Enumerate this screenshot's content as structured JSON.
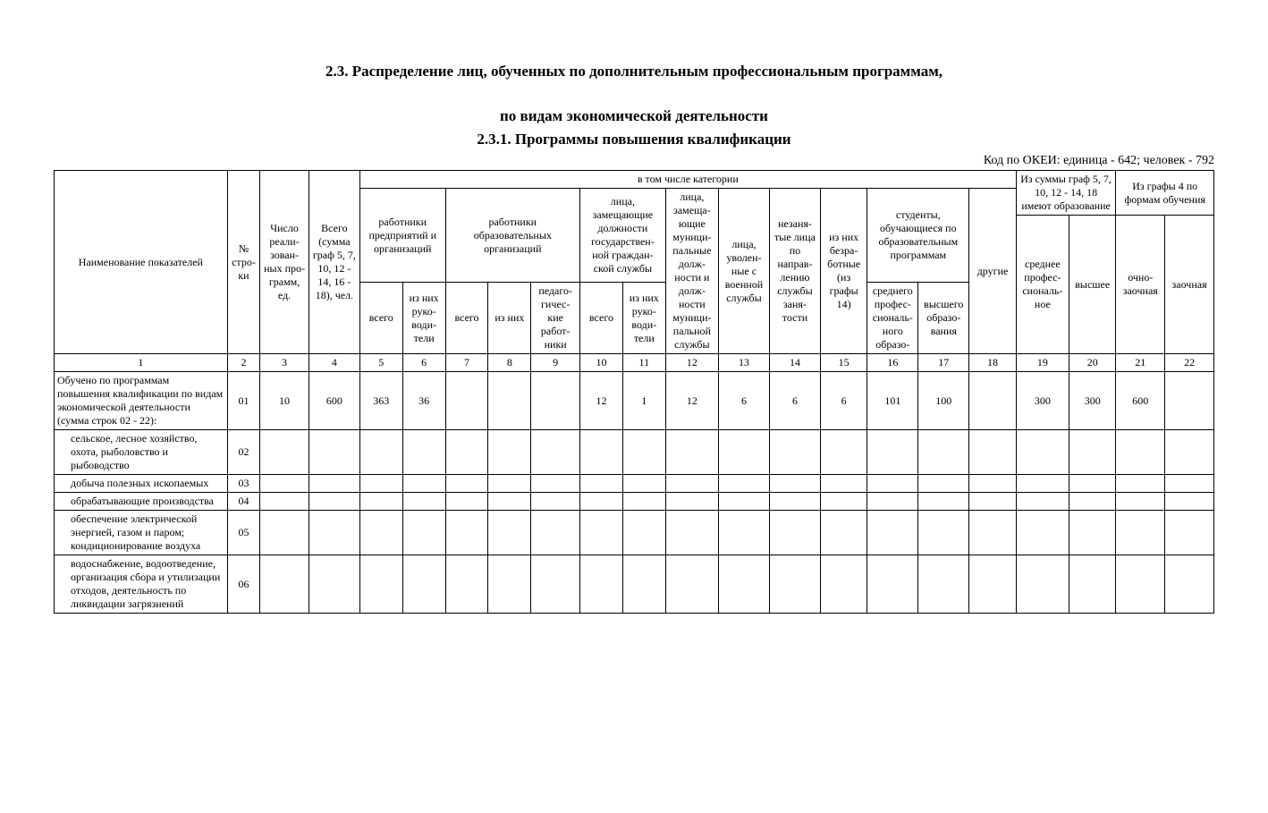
{
  "title_line1": "2.3. Распределение лиц, обученных по дополнительным профессиональным программам,",
  "title_line2": "по видам экономической деятельности",
  "section_title": "2.3.1. Программы повышения квалификации",
  "okei_note": "Код по ОКЕИ: единица - 642; человек - 792",
  "header": {
    "name": "Наименование показателей",
    "row_no": "№ стро-ки",
    "num_prog": "Число реали-зован-ных про-грамм, ед.",
    "total": "Всего (сумма граф 5, 7, 10, 12 - 14, 16 - 18), чел.",
    "categories": "в том числе категории",
    "from_sum_5": "Из суммы граф 5, 7, 10, 12 - 14, 18 имеют образование",
    "from_graph4": "Из графы 4 по формам обучения",
    "enterprise_workers": "работники предприятий и организаций",
    "edu_workers": "работники образовательных организаций",
    "state_service": "лица, замещающие должности государствен-ной граждан-ской службы",
    "muni_service": "лица, замеща-ющие муници-пальные долж-ности и долж-ности муници-пальной службы",
    "military": "лица, уволен-ные с военной службы",
    "unemployed": "незаня-тые лица по направ-лению службы заня-тости",
    "of_them_unemp": "из них безра-ботные (из графы 14)",
    "students": "студенты, обучающиеся по образовательным программам",
    "others": "другие",
    "secondary_prof": "среднее профес-сиональ-ное",
    "higher": "высшее",
    "full_part": "очно-заочная",
    "distance": "заочная",
    "vsego": "всего",
    "of_them_mgr": "из них руко-води-тели",
    "of_them": "из них",
    "mgr": "руко-води-тели",
    "ped_workers": "педаго-гичес-кие работ-ники",
    "spo": "среднего профес-сиональ-ного образо-",
    "vo": "высшего образо-вания"
  },
  "col_numbers": [
    "1",
    "2",
    "3",
    "4",
    "5",
    "6",
    "7",
    "8",
    "9",
    "10",
    "11",
    "12",
    "13",
    "14",
    "15",
    "16",
    "17",
    "18",
    "19",
    "20",
    "21",
    "22"
  ],
  "rows": [
    {
      "name": "Обучено по программам повышения квалификации по видам экономической деятельности (сумма строк 02 - 22):",
      "indent": false,
      "no": "01",
      "c3": "10",
      "c4": "600",
      "c5": "363",
      "c6": "36",
      "c7": "",
      "c8": "",
      "c9": "",
      "c10": "12",
      "c11": "1",
      "c12": "12",
      "c13": "6",
      "c14": "6",
      "c15": "6",
      "c16": "101",
      "c17": "100",
      "c18": "",
      "c19": "300",
      "c20": "300",
      "c21": "600",
      "c22": ""
    },
    {
      "name": "сельское, лесное хозяйство, охота, рыболовство и рыбоводство",
      "indent": true,
      "no": "02",
      "c3": "",
      "c4": "",
      "c5": "",
      "c6": "",
      "c7": "",
      "c8": "",
      "c9": "",
      "c10": "",
      "c11": "",
      "c12": "",
      "c13": "",
      "c14": "",
      "c15": "",
      "c16": "",
      "c17": "",
      "c18": "",
      "c19": "",
      "c20": "",
      "c21": "",
      "c22": ""
    },
    {
      "name": "добыча полезных ископаемых",
      "indent": true,
      "no": "03",
      "c3": "",
      "c4": "",
      "c5": "",
      "c6": "",
      "c7": "",
      "c8": "",
      "c9": "",
      "c10": "",
      "c11": "",
      "c12": "",
      "c13": "",
      "c14": "",
      "c15": "",
      "c16": "",
      "c17": "",
      "c18": "",
      "c19": "",
      "c20": "",
      "c21": "",
      "c22": ""
    },
    {
      "name": "обрабатывающие производства",
      "indent": true,
      "no": "04",
      "c3": "",
      "c4": "",
      "c5": "",
      "c6": "",
      "c7": "",
      "c8": "",
      "c9": "",
      "c10": "",
      "c11": "",
      "c12": "",
      "c13": "",
      "c14": "",
      "c15": "",
      "c16": "",
      "c17": "",
      "c18": "",
      "c19": "",
      "c20": "",
      "c21": "",
      "c22": ""
    },
    {
      "name": "обеспечение электрической энергией, газом и паром; кондиционирование воздуха",
      "indent": true,
      "no": "05",
      "c3": "",
      "c4": "",
      "c5": "",
      "c6": "",
      "c7": "",
      "c8": "",
      "c9": "",
      "c10": "",
      "c11": "",
      "c12": "",
      "c13": "",
      "c14": "",
      "c15": "",
      "c16": "",
      "c17": "",
      "c18": "",
      "c19": "",
      "c20": "",
      "c21": "",
      "c22": ""
    },
    {
      "name": "водоснабжение, водоотведение, организация сбора и утилизации отходов, деятельность по ликвидации загрязнений",
      "indent": true,
      "no": "06",
      "c3": "",
      "c4": "",
      "c5": "",
      "c6": "",
      "c7": "",
      "c8": "",
      "c9": "",
      "c10": "",
      "c11": "",
      "c12": "",
      "c13": "",
      "c14": "",
      "c15": "",
      "c16": "",
      "c17": "",
      "c18": "",
      "c19": "",
      "c20": "",
      "c21": "",
      "c22": ""
    }
  ]
}
